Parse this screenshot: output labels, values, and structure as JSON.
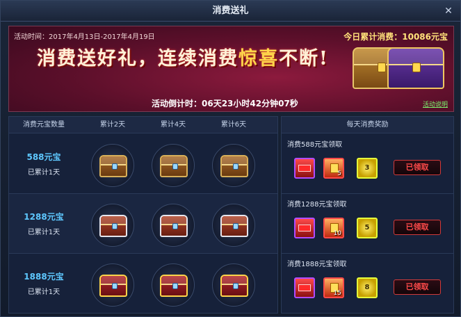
{
  "window": {
    "title": "消费送礼",
    "close_icon": "close-icon"
  },
  "banner": {
    "period": "活动时间：2017年4月13日-2017年4月19日",
    "total_label": "今日累计消费：10086元宝",
    "slogan_part1": "消费送好礼，连续消费",
    "slogan_accent": "惊喜",
    "slogan_part2": "不断!",
    "countdown": "活动倒计时：06天23小时42分钟07秒",
    "desc_link": "活动说明"
  },
  "left_table": {
    "headers": [
      "消费元宝数量",
      "累计2天",
      "累计4天",
      "累计6天"
    ],
    "rows": [
      {
        "amount": "588元宝",
        "days": "已累计1天",
        "chest_style": "wood"
      },
      {
        "amount": "1288元宝",
        "days": "已累计1天",
        "chest_style": "silver"
      },
      {
        "amount": "1888元宝",
        "days": "已累计1天",
        "chest_style": "gold"
      }
    ]
  },
  "right_panel": {
    "header": "每天消费奖励",
    "sections": [
      {
        "title": "消费588元宝领取",
        "counts": [
          "",
          "5",
          "3"
        ],
        "button": "已领取"
      },
      {
        "title": "消费1288元宝领取",
        "counts": [
          "",
          "10",
          "5"
        ],
        "button": "已领取"
      },
      {
        "title": "消费1888元宝领取",
        "counts": [
          "",
          "15",
          "8"
        ],
        "button": "已领取"
      }
    ]
  }
}
